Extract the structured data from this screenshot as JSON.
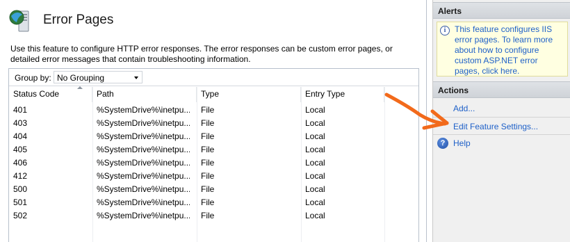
{
  "page": {
    "title": "Error Pages",
    "description": "Use this feature to configure HTTP error responses. The error responses can be custom error pages, or detailed error messages that contain troubleshooting information.",
    "icon": "server-error-icon"
  },
  "groupby": {
    "label": "Group by:",
    "value": "No Grouping"
  },
  "table": {
    "columns": [
      "Status Code",
      "Path",
      "Type",
      "Entry Type"
    ],
    "rows": [
      [
        "401",
        "%SystemDrive%\\inetpu...",
        "File",
        "Local"
      ],
      [
        "403",
        "%SystemDrive%\\inetpu...",
        "File",
        "Local"
      ],
      [
        "404",
        "%SystemDrive%\\inetpu...",
        "File",
        "Local"
      ],
      [
        "405",
        "%SystemDrive%\\inetpu...",
        "File",
        "Local"
      ],
      [
        "406",
        "%SystemDrive%\\inetpu...",
        "File",
        "Local"
      ],
      [
        "412",
        "%SystemDrive%\\inetpu...",
        "File",
        "Local"
      ],
      [
        "500",
        "%SystemDrive%\\inetpu...",
        "File",
        "Local"
      ],
      [
        "501",
        "%SystemDrive%\\inetpu...",
        "File",
        "Local"
      ],
      [
        "502",
        "%SystemDrive%\\inetpu...",
        "File",
        "Local"
      ]
    ]
  },
  "alerts": {
    "header": "Alerts",
    "message": "This feature configures IIS error pages. To learn more about how to configure custom ASP.NET error pages, click here."
  },
  "actions": {
    "header": "Actions",
    "items": [
      {
        "label": "Add...",
        "icon": ""
      },
      {
        "label": "Edit Feature Settings...",
        "icon": ""
      },
      {
        "label": "Help",
        "icon": "help-icon"
      }
    ]
  },
  "colors": {
    "link": "#1e60c8",
    "annotation_arrow": "#f26a1b",
    "alert_bg": "#ffffe1"
  }
}
